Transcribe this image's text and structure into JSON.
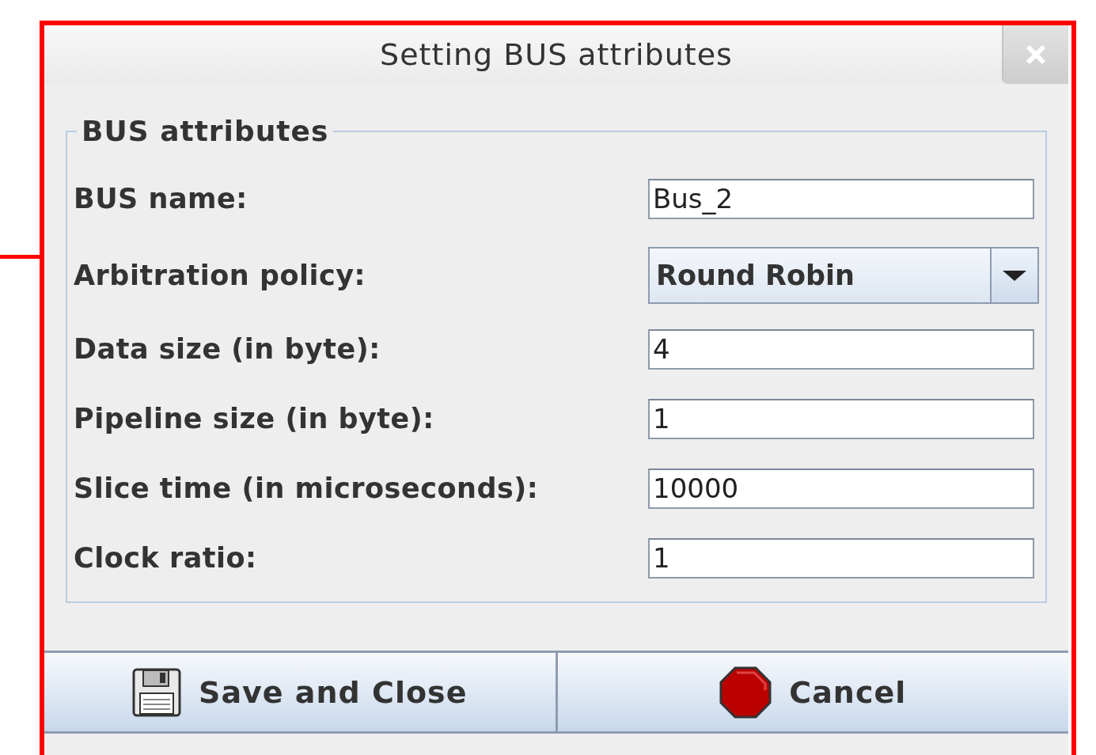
{
  "window": {
    "title": "Setting BUS attributes"
  },
  "group": {
    "legend": "BUS attributes",
    "fields": [
      {
        "kind": "text",
        "label": "BUS name:",
        "value": "Bus_2"
      },
      {
        "kind": "dropdown",
        "label": "Arbitration policy:",
        "value": "Round Robin"
      },
      {
        "kind": "text",
        "label": "Data size (in byte):",
        "value": "4"
      },
      {
        "kind": "text",
        "label": "Pipeline size (in byte):",
        "value": "1"
      },
      {
        "kind": "text",
        "label": "Slice time (in microseconds):",
        "value": "10000"
      },
      {
        "kind": "text",
        "label": "Clock ratio:",
        "value": "1"
      }
    ]
  },
  "buttons": [
    {
      "kind": "save",
      "label": "Save and Close"
    },
    {
      "kind": "cancel",
      "label": "Cancel"
    }
  ]
}
